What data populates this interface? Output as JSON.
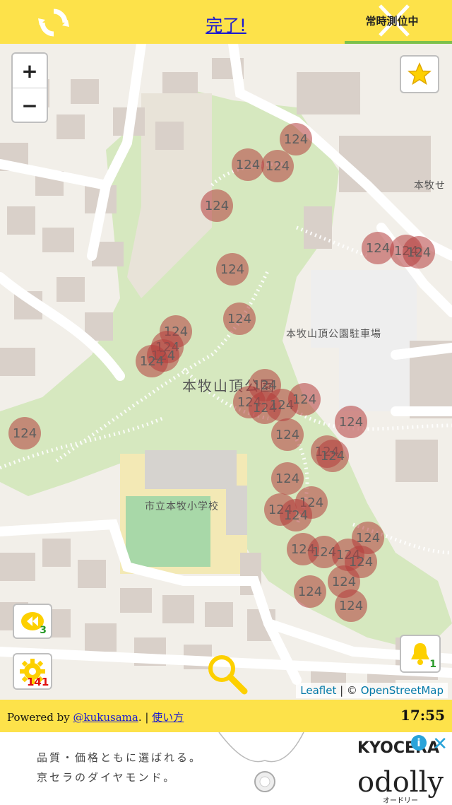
{
  "header": {
    "done_label": "完了!",
    "always_measuring_label": "常時測位中"
  },
  "map": {
    "zoom_in_label": "+",
    "zoom_out_label": "−",
    "labels": {
      "park": "本牧山頂公園",
      "parking": "本牧山頂公園駐車場",
      "school": "市立本牧小学校",
      "top_right": "本牧せ"
    },
    "marker_value": "124",
    "badges": {
      "history_count": "3",
      "settings_count": "141",
      "notifications_count": "1"
    },
    "attribution": {
      "leaflet": "Leaflet",
      "separator": " | © ",
      "osm": "OpenStreetMap"
    },
    "colors": {
      "park_green": "#d6e8bf",
      "marker": "#b43c3c",
      "accent_yellow": "#fde24a"
    }
  },
  "footer": {
    "powered_prefix": "Powered by ",
    "powered_link": "@kukusama",
    "powered_suffix": ". | ",
    "usage_link": "使い方",
    "time": "17:55"
  },
  "ad": {
    "line1": "品質・価格ともに選ばれる。",
    "line2": "京セラのダイヤモンド。",
    "brand": "KYOCERA",
    "logo": "odolly",
    "logo_sub": "オードリー",
    "info_icon": "i",
    "close_icon": "✕"
  }
}
